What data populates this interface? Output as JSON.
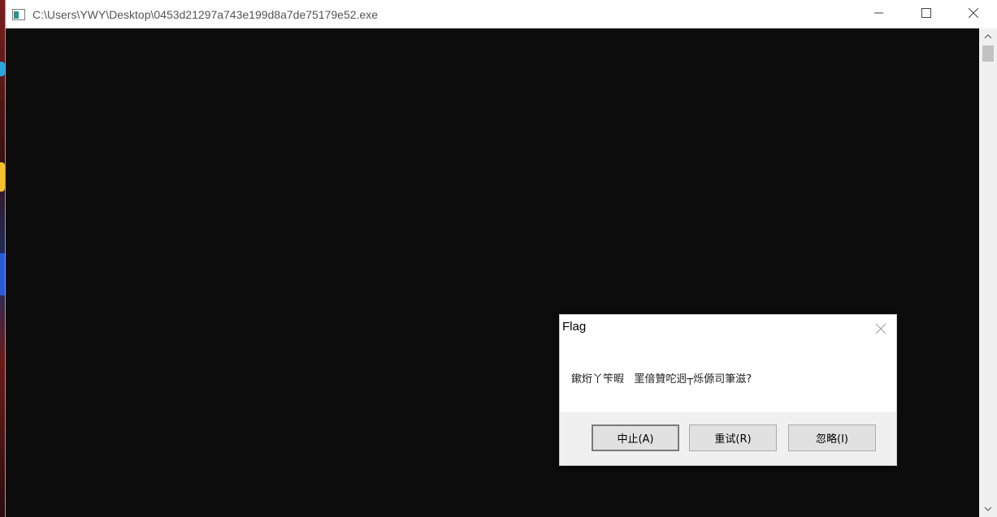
{
  "window": {
    "title": "C:\\Users\\YWY\\Desktop\\0453d21297a743e199d8a7de75179e52.exe",
    "icon": "console-app-icon",
    "controls": {
      "minimize": "minimize-icon",
      "maximize": "maximize-icon",
      "close": "close-icon"
    }
  },
  "dialog": {
    "title": "Flag",
    "message": "鏉烆丫笇暇   罣偣贊咜迥┬烁傆司筆滋?",
    "buttons": {
      "abort": "中止(A)",
      "retry": "重试(R)",
      "ignore": "忽略(I)"
    }
  },
  "colors": {
    "console_bg": "#0c0c0c",
    "dialog_footer": "#f0f0f0",
    "button_face": "#e1e1e1"
  }
}
